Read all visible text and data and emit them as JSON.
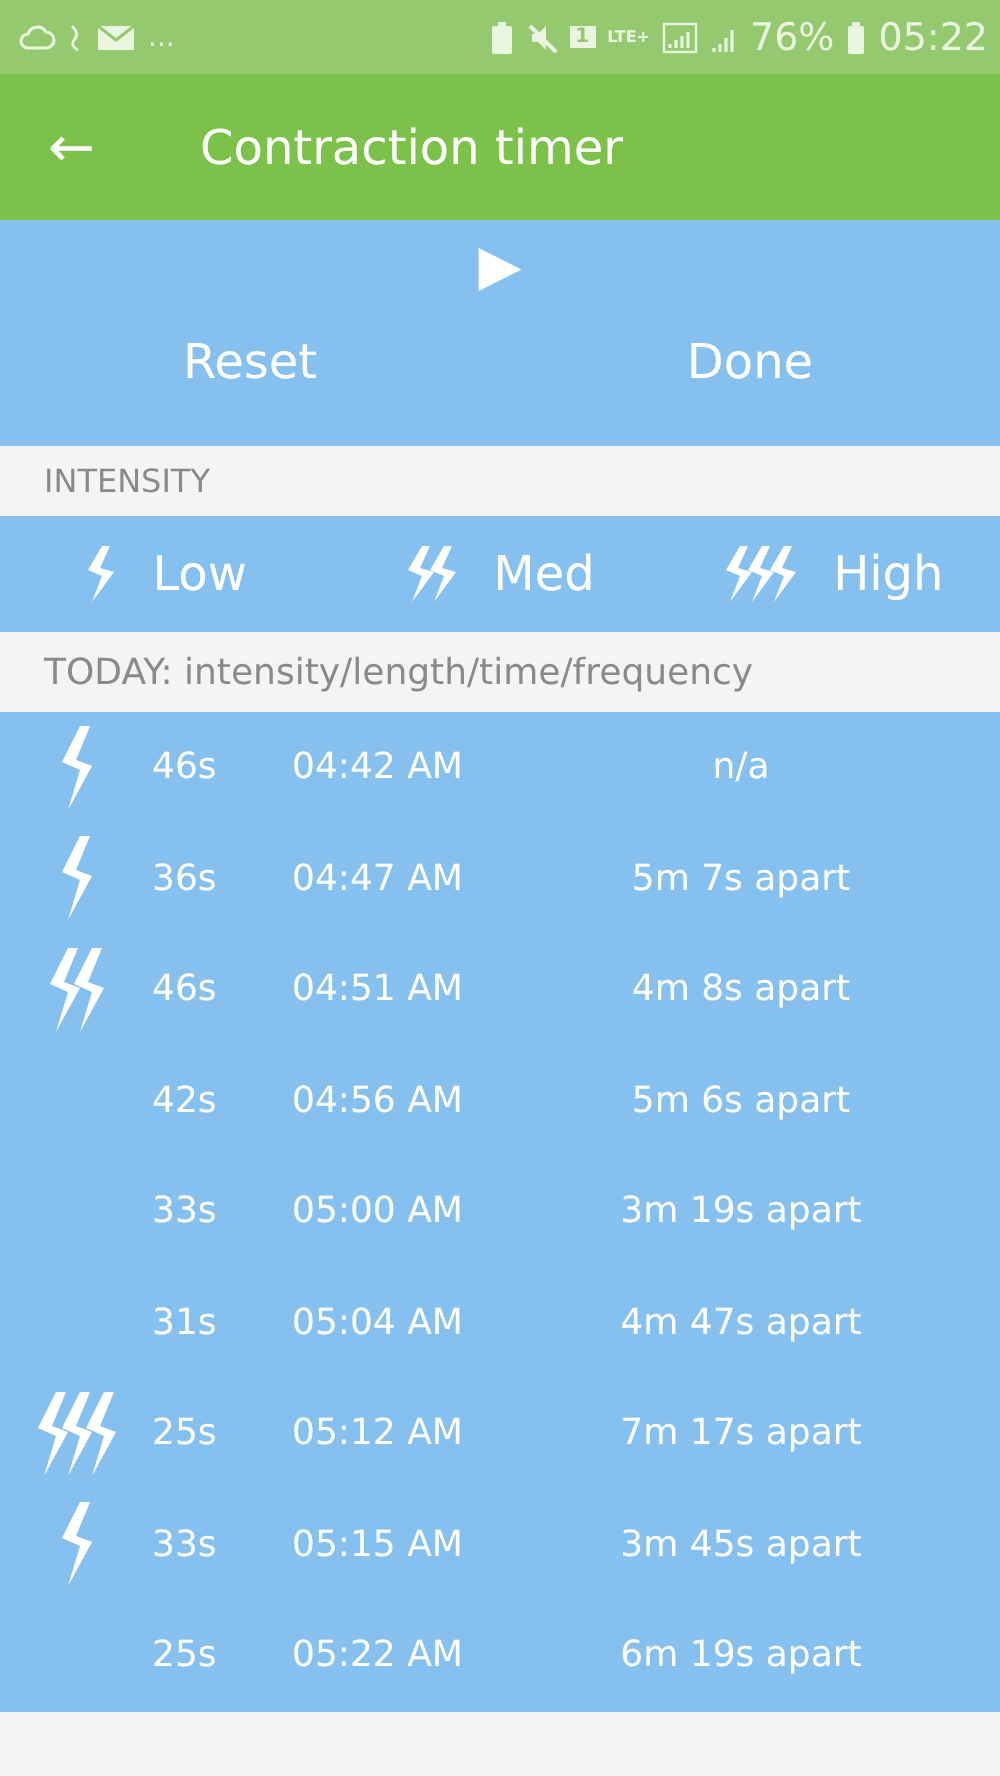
{
  "status_bar": {
    "more": "...",
    "sim": "1",
    "network": "LTE+",
    "battery": "76%",
    "time": "05:22"
  },
  "toolbar": {
    "back": "←",
    "title": "Contraction timer"
  },
  "controls": {
    "play": "▶",
    "buttons": [
      "Reset",
      "Done"
    ]
  },
  "intensity_header": "INTENSITY",
  "intensities": [
    {
      "kind": "low",
      "label": "Low"
    },
    {
      "kind": "med",
      "label": "Med"
    },
    {
      "kind": "high",
      "label": "High"
    }
  ],
  "today_header": "TODAY: intensity/length/time/frequency",
  "rows": [
    {
      "kind": "low",
      "length": "46s",
      "time": "04:42 AM",
      "frequency": "n/a"
    },
    {
      "kind": "low",
      "length": "36s",
      "time": "04:47 AM",
      "frequency": "5m 7s apart"
    },
    {
      "kind": "med",
      "length": "46s",
      "time": "04:51 AM",
      "frequency": "4m 8s apart"
    },
    {
      "kind": "none",
      "length": "42s",
      "time": "04:56 AM",
      "frequency": "5m 6s apart"
    },
    {
      "kind": "none",
      "length": "33s",
      "time": "05:00 AM",
      "frequency": "3m 19s apart"
    },
    {
      "kind": "none",
      "length": "31s",
      "time": "05:04 AM",
      "frequency": "4m 47s apart"
    },
    {
      "kind": "high",
      "length": "25s",
      "time": "05:12 AM",
      "frequency": "7m 17s apart"
    },
    {
      "kind": "low",
      "length": "33s",
      "time": "05:15 AM",
      "frequency": "3m 45s apart"
    },
    {
      "kind": "none",
      "length": "25s",
      "time": "05:22 AM",
      "frequency": "6m 19s apart"
    }
  ]
}
